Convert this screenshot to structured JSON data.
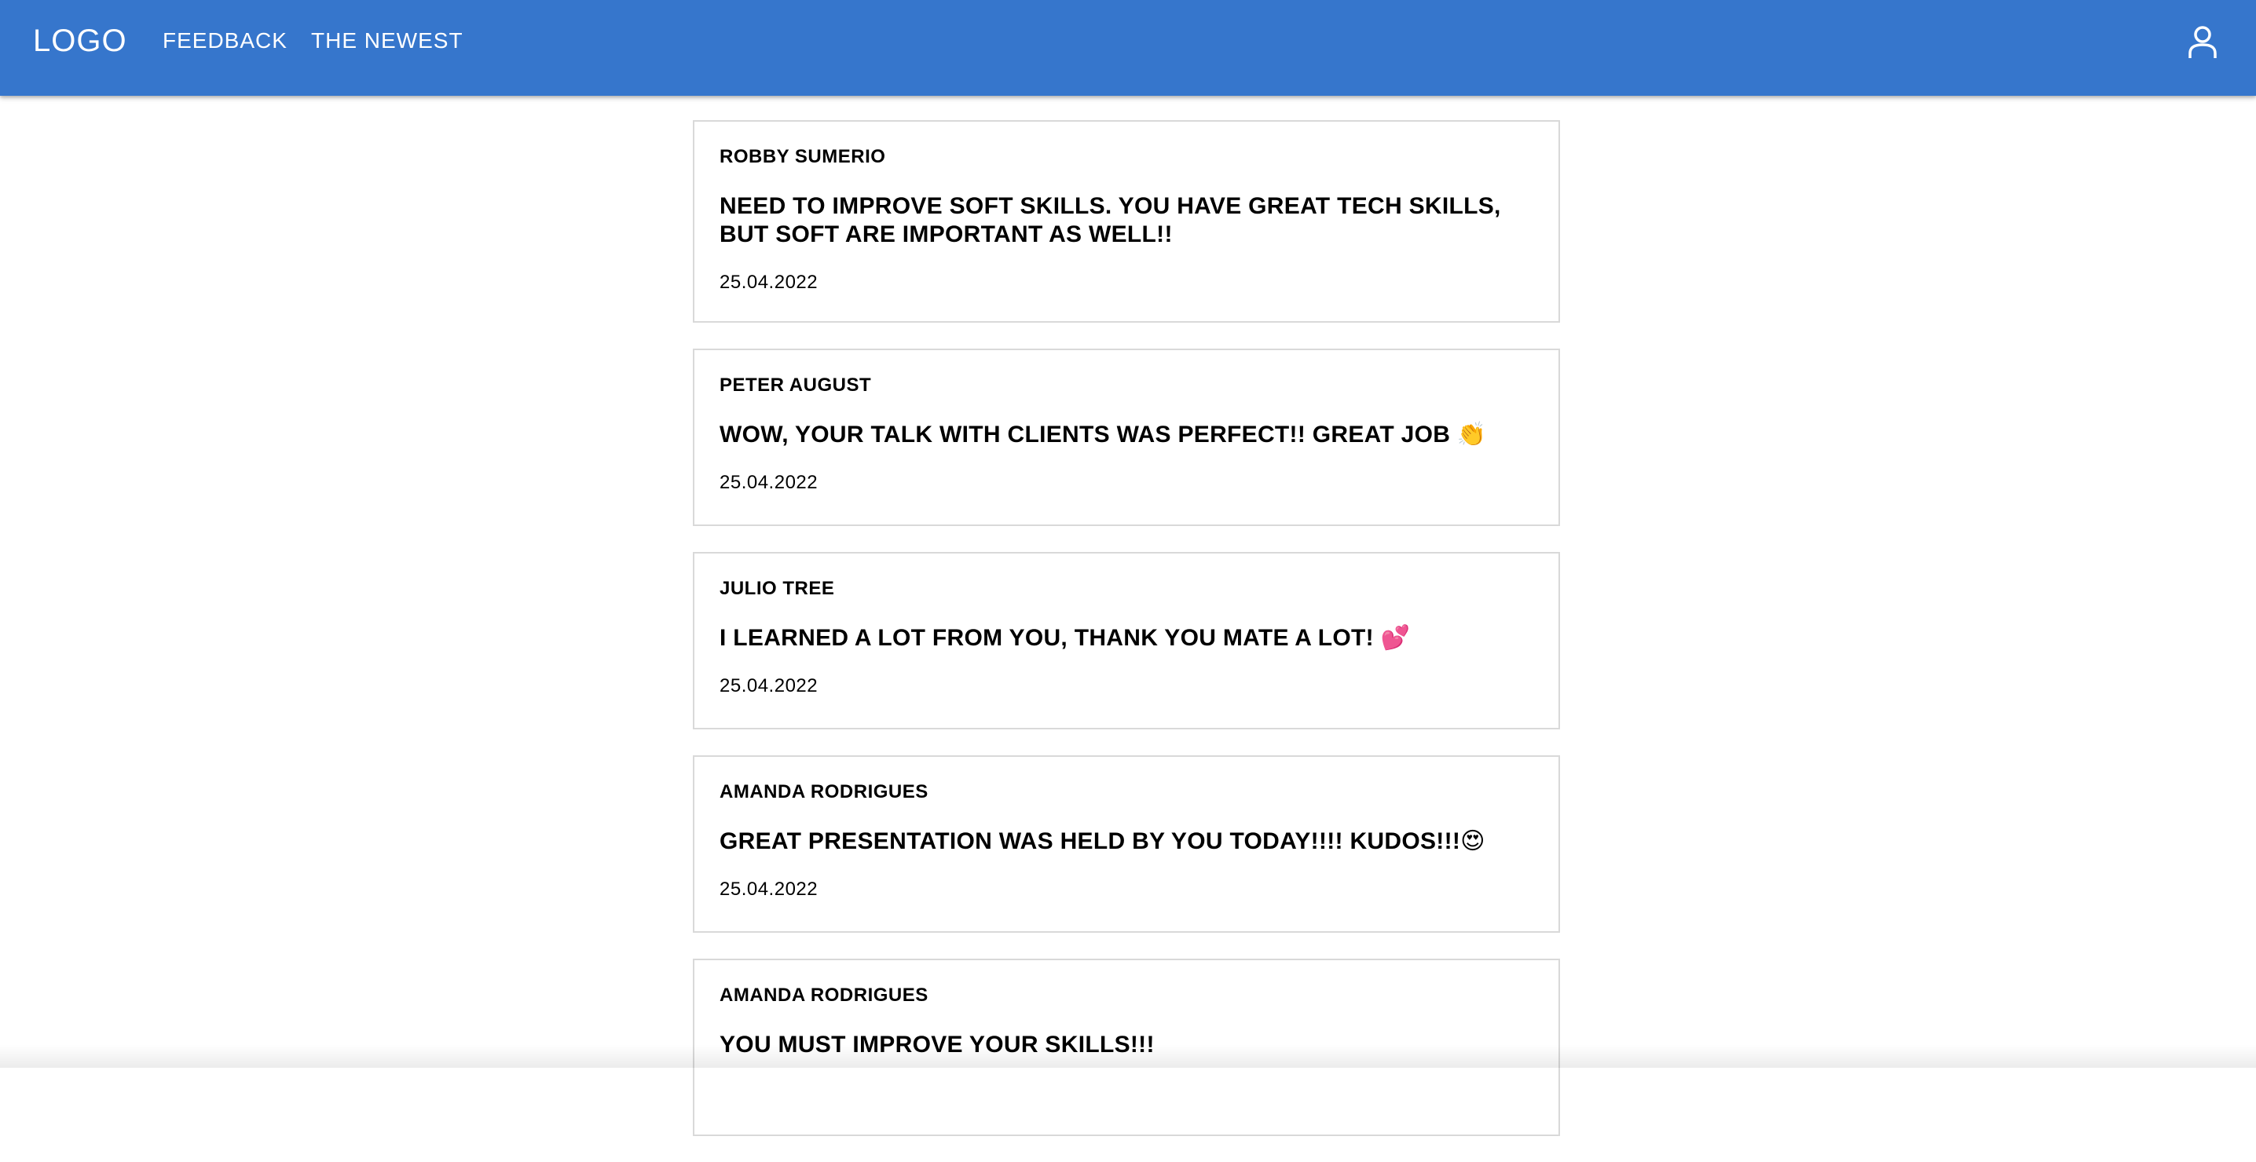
{
  "header": {
    "logo": "LOGO",
    "nav": [
      {
        "label": "FEEDBACK"
      },
      {
        "label": "THE NEWEST"
      }
    ],
    "user_icon": "account-icon",
    "background_color": "#3676cc",
    "text_color": "#ffffff"
  },
  "feedback": [
    {
      "author": "ROBBY SUMERIO",
      "message": "NEED TO IMPROVE SOFT SKILLS. YOU HAVE GREAT TECH SKILLS, BUT SOFT ARE IMPORTANT AS WELL!!",
      "date": "25.04.2022"
    },
    {
      "author": "PETER AUGUST",
      "message": "WOW, YOUR TALK WITH CLIENTS WAS PERFECT!! GREAT JOB 👏",
      "date": "25.04.2022"
    },
    {
      "author": "JULIO TREE",
      "message": "I LEARNED A LOT FROM YOU, THANK YOU MATE A LOT! 💕",
      "date": "25.04.2022"
    },
    {
      "author": "AMANDA RODRIGUES",
      "message": "GREAT PRESENTATION WAS HELD BY YOU TODAY!!!! KUDOS!!!😍",
      "date": "25.04.2022"
    },
    {
      "author": "AMANDA RODRIGUES",
      "message": "YOU MUST IMPROVE YOUR SKILLS!!!",
      "date": ""
    }
  ]
}
